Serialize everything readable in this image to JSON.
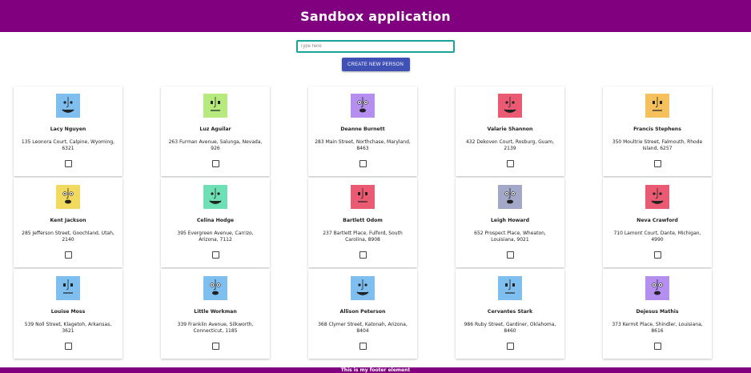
{
  "header": {
    "title": "Sandbox application"
  },
  "search": {
    "placeholder": "Type here",
    "value": ""
  },
  "create_button": {
    "label": "CREATE NEW PERSON"
  },
  "footer": {
    "text": "This is my footer element"
  },
  "colors": {
    "header": "#800080",
    "button": "#3f51b5",
    "input_border": "#1aa39a"
  },
  "people": [
    {
      "name": "Lacy Nguyen",
      "address": "135 Leonora Court, Calpine, Wyoming, 6321",
      "avatar_color": "#7fbfef",
      "avatar_icon": "monster-avatar-icon",
      "checked": false
    },
    {
      "name": "Luz Aguilar",
      "address": "263 Furman Avenue, Salunga, Nevada, 926",
      "avatar_color": "#b6ea7e",
      "avatar_icon": "monster-avatar-icon",
      "checked": false
    },
    {
      "name": "Deanne Burnett",
      "address": "283 Main Street, Northchase, Maryland, 8463",
      "avatar_color": "#b48ff0",
      "avatar_icon": "monster-avatar-icon",
      "checked": false
    },
    {
      "name": "Valarie Shannon",
      "address": "432 Dekoven Court, Rosburg, Guam, 2139",
      "avatar_color": "#ea5a72",
      "avatar_icon": "monster-avatar-icon",
      "checked": false
    },
    {
      "name": "Francis Stephens",
      "address": "350 Moultrie Street, Falmouth, Rhode Island, 6257",
      "avatar_color": "#f6c05c",
      "avatar_icon": "monster-avatar-icon",
      "checked": false
    },
    {
      "name": "Kent Jackson",
      "address": "285 Jefferson Street, Goochland, Utah, 2140",
      "avatar_color": "#f2da5e",
      "avatar_icon": "monster-avatar-icon",
      "checked": false
    },
    {
      "name": "Celina Hodge",
      "address": "395 Evergreen Avenue, Carrizo, Arizona, 7112",
      "avatar_color": "#6fe0b5",
      "avatar_icon": "monster-avatar-icon",
      "checked": false
    },
    {
      "name": "Bartlett Odom",
      "address": "237 Bartlett Place, Fulford, South Carolina, 8908",
      "avatar_color": "#ea5a72",
      "avatar_icon": "monster-avatar-icon",
      "checked": false
    },
    {
      "name": "Leigh Howard",
      "address": "652 Prospect Place, Wheaton, Louisiana, 9021",
      "avatar_color": "#a3a8c8",
      "avatar_icon": "monster-avatar-icon",
      "checked": false
    },
    {
      "name": "Neva Crawford",
      "address": "710 Lamont Court, Dante, Michigan, 4990",
      "avatar_color": "#ea5a72",
      "avatar_icon": "monster-avatar-icon",
      "checked": false
    },
    {
      "name": "Louise Moss",
      "address": "539 Noll Street, Klagetoh, Arkansas, 3621",
      "avatar_color": "#7fbfef",
      "avatar_icon": "monster-avatar-icon",
      "checked": false
    },
    {
      "name": "Little Workman",
      "address": "339 Franklin Avenue, Silkworth, Connecticut, 1185",
      "avatar_color": "#7fbfef",
      "avatar_icon": "monster-avatar-icon",
      "checked": false
    },
    {
      "name": "Allison Peterson",
      "address": "368 Clymer Street, Katonah, Arizona, 8404",
      "avatar_color": "#7fbfef",
      "avatar_icon": "monster-avatar-icon",
      "checked": false
    },
    {
      "name": "Cervantes Stark",
      "address": "986 Ruby Street, Gardiner, Oklahoma, 8460",
      "avatar_color": "#7fbfef",
      "avatar_icon": "monster-avatar-icon",
      "checked": false
    },
    {
      "name": "Dejesus Mathis",
      "address": "373 Kermit Place, Shindler, Louisiana, 8616",
      "avatar_color": "#b48ff0",
      "avatar_icon": "monster-avatar-icon",
      "checked": false
    }
  ]
}
